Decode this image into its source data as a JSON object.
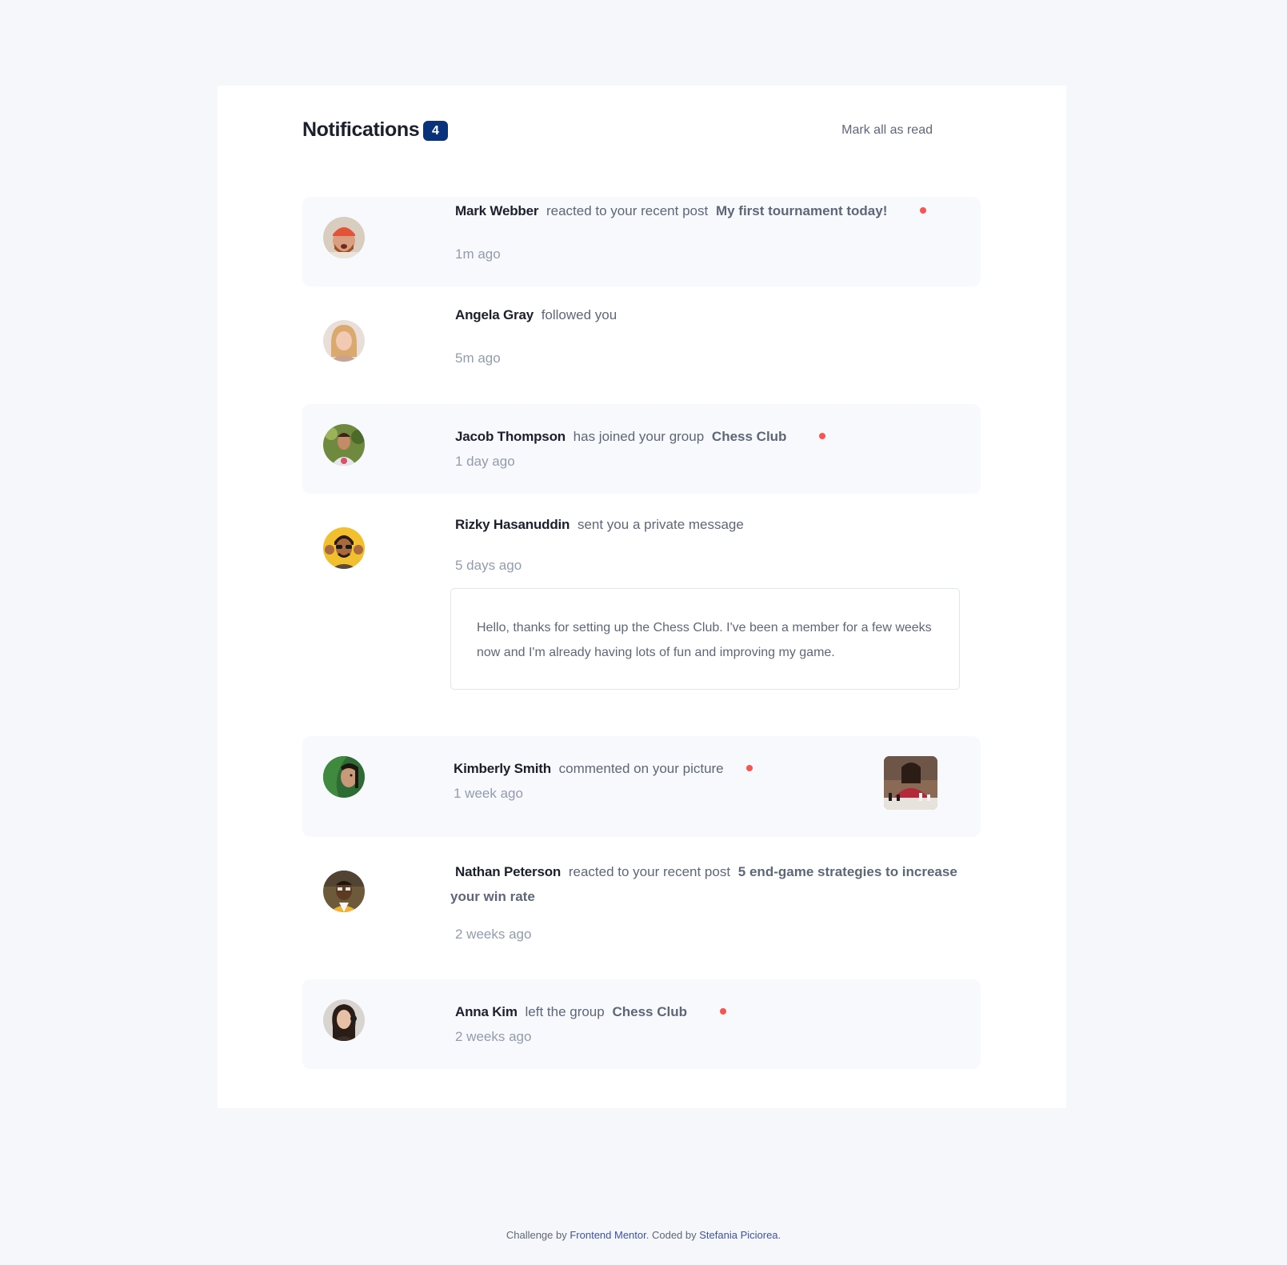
{
  "header": {
    "title": "Notifications",
    "unread_count": "4",
    "mark_all_label": "Mark all as read"
  },
  "notifications": [
    {
      "name": "Mark Webber",
      "action": "reacted to your recent post",
      "target": "My first tournament today!",
      "time": "1m ago",
      "unread": true
    },
    {
      "name": "Angela Gray",
      "action": "followed you",
      "target": "",
      "time": "5m ago",
      "unread": false
    },
    {
      "name": "Jacob Thompson",
      "action": "has joined your group",
      "target": "Chess Club",
      "time": "1 day ago",
      "unread": true
    },
    {
      "name": "Rizky Hasanuddin",
      "action": "sent you a private message",
      "target": "",
      "time": "5 days ago",
      "unread": false,
      "message": "Hello, thanks for setting up the Chess Club. I've been a member for a few weeks now and I'm already having lots of fun and improving my game."
    },
    {
      "name": "Kimberly Smith",
      "action": "commented on your picture",
      "target": "",
      "time": "1 week ago",
      "unread": true
    },
    {
      "name": "Nathan Peterson",
      "action": "reacted to your recent post",
      "target_line1": "5 end-game strategies to increase",
      "target_line2": "your win rate",
      "time": "2 weeks ago",
      "unread": false
    },
    {
      "name": "Anna Kim",
      "action": "left the group",
      "target": "Chess Club",
      "time": "2 weeks ago",
      "unread": true
    }
  ],
  "footer": {
    "prefix": "Challenge by",
    "challenge_link": "Frontend Mentor",
    "middle": ". Coded by",
    "author_link": "Stefania Piciorea",
    "suffix": "."
  },
  "colors": {
    "background": "#f6f7fa",
    "unread_background": "#f7f9fd",
    "badge": "#0a327b",
    "unread_dot": "#f65552",
    "dark_text": "#1c202b",
    "muted_text": "#5e6778",
    "time_text": "#939cad",
    "link": "#3e52a3"
  }
}
